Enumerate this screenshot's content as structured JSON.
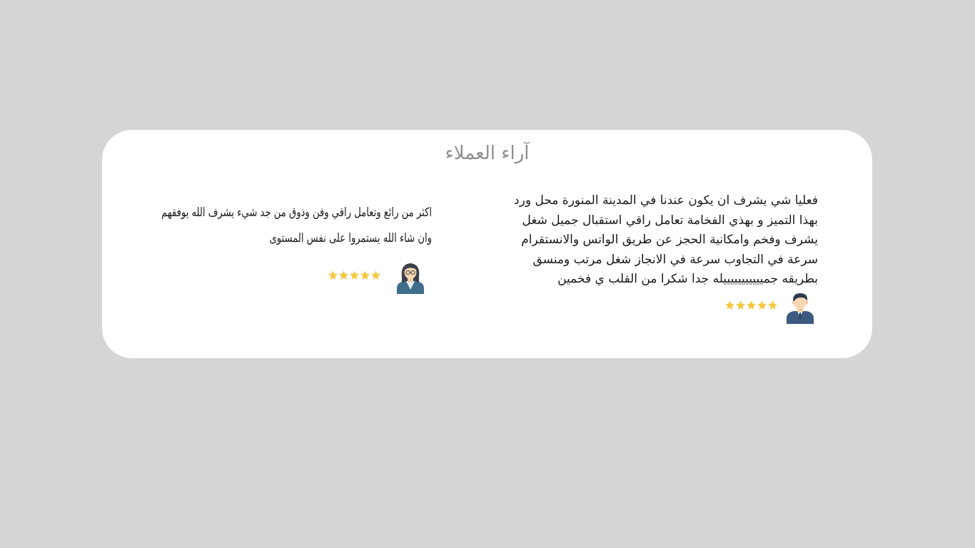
{
  "section": {
    "title": "آراء العملاء"
  },
  "reviews": [
    {
      "text": "فعليا شي يشرف ان يكون عندنا في المدينة  المنورة محل ورد\nبهذا التميز و بهذي الفخامة  تعامل راقي استقبال جميل شغل\nيشرف وفخم  وامكانية الحجز عن طريق الواتس  والانستقرام\nسرعة في التجاوب سرعة في الانجاز شغل مرتب ومنسق\nبطريقه جميييييييييييله جدا  شكرا من القلب ي فخمين",
      "rating": 5,
      "avatar": "male-avatar-icon",
      "star_color": "#f5c842"
    },
    {
      "text": "اكثر من رائع وتعامل راقي وفن وذوق من جد شيء يشرف الله يوفقهم\nوان شاء الله يستمروا على نفس المستوى",
      "rating": 5,
      "avatar": "female-avatar-icon",
      "star_color": "#f5c842"
    }
  ]
}
